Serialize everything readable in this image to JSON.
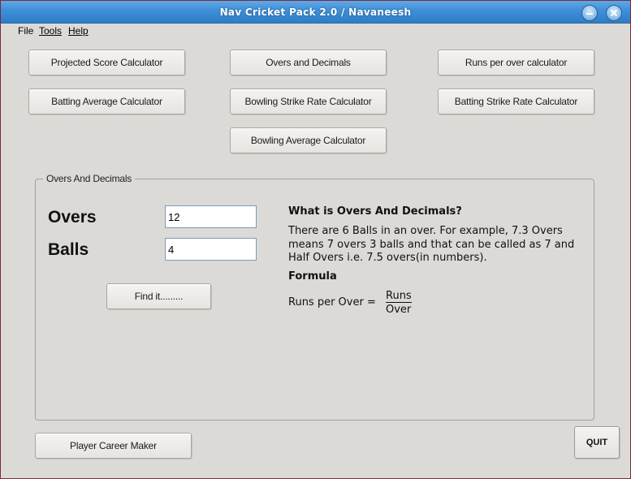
{
  "window": {
    "title": "Nav Cricket Pack 2.0   /  Navaneesh",
    "minimize_icon": "minimize-icon",
    "close_icon": "close-icon"
  },
  "menu": {
    "file": "File",
    "tools": "Tools",
    "help": "Help"
  },
  "calculators": {
    "projected_score": "Projected Score Calculator",
    "overs_decimals": "Overs and Decimals",
    "runs_per_over": "Runs per over calculator",
    "batting_average": "Batting Average Calculator",
    "bowling_strike_rate": "Bowling Strike Rate Calculator",
    "batting_strike_rate": "Batting Strike Rate Calculator",
    "bowling_average": "Bowling Average Calculator"
  },
  "group": {
    "title": "Overs And Decimals",
    "overs_label": "Overs",
    "overs_value": "12",
    "balls_label": "Balls",
    "balls_value": "4",
    "find_button": "Find it.........",
    "info_title": "What is Overs And Decimals?",
    "info_body": "There are 6 Balls in an over. For example, 7.3 Overs means 7 overs 3 balls and that can be called as 7 and Half Overs i.e. 7.5 overs(in numbers).",
    "formula_title": "Formula",
    "formula_lhs": "Runs per Over  =",
    "formula_numerator": "Runs",
    "formula_denominator": "Over"
  },
  "footer": {
    "career_maker": "Player Career Maker",
    "quit": "QUIT"
  }
}
